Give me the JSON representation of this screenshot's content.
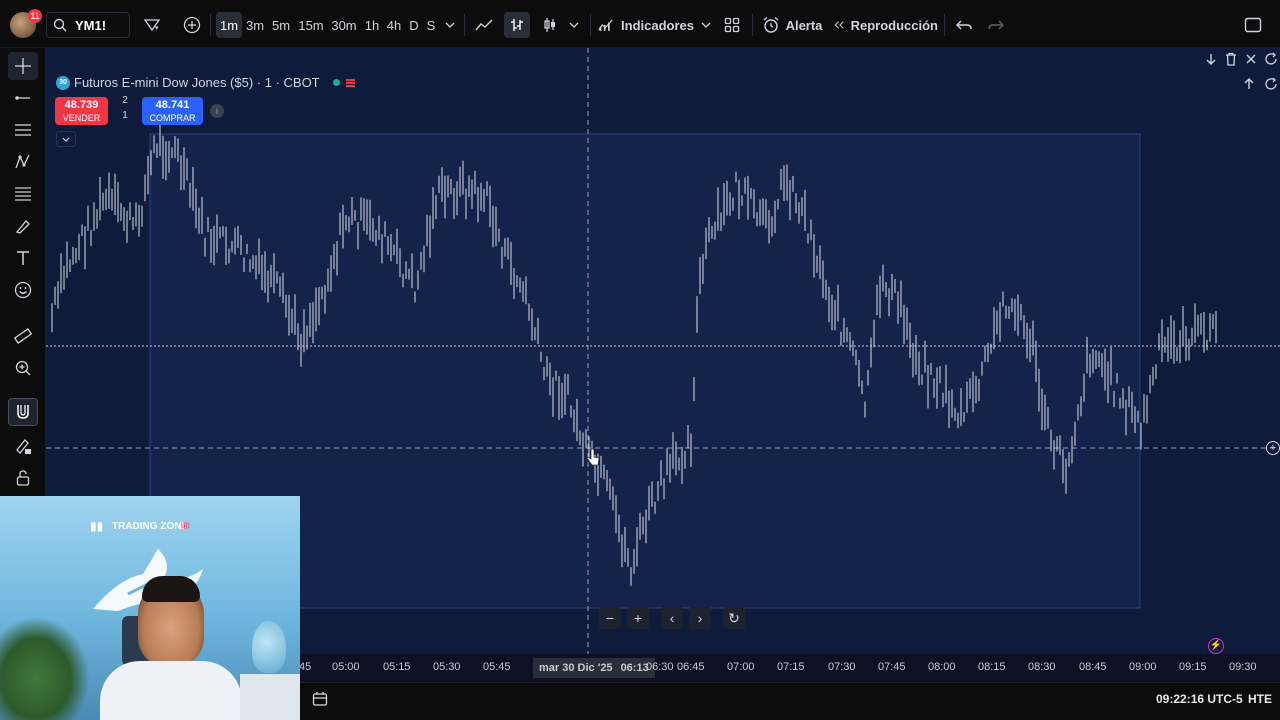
{
  "topbar": {
    "avatar_badge": "11",
    "symbol": "YM1!",
    "intervals": [
      {
        "label": "1m",
        "active": true
      },
      {
        "label": "3m"
      },
      {
        "label": "5m"
      },
      {
        "label": "15m"
      },
      {
        "label": "30m"
      },
      {
        "label": "1h"
      },
      {
        "label": "4h"
      },
      {
        "label": "D"
      },
      {
        "label": "S"
      }
    ],
    "indicators_label": "Indicadores",
    "alert_label": "Alerta",
    "replay_label": "Reproducción"
  },
  "chart": {
    "title": "Futuros E-mini Dow Jones ($5) · 1 · CBOT",
    "title_badge": "30",
    "sell": {
      "price": "48.739",
      "label": "VENDER"
    },
    "buy": {
      "price": "48.741",
      "label": "COMPRAR"
    },
    "spread_top": "2",
    "spread_bottom": "1",
    "colors": {
      "background": "#0f1b3a",
      "bar": "#d8dde9",
      "sell": "#f23645",
      "buy": "#2962ff"
    }
  },
  "time_axis": {
    "labels": [
      "45",
      "05:00",
      "05:15",
      "05:30",
      "05:45",
      "06:30",
      "06:45",
      "07:00",
      "07:15",
      "07:30",
      "07:45",
      "08:00",
      "08:15",
      "08:30",
      "08:45",
      "09:00",
      "09:15",
      "09:30"
    ],
    "crosshair_date": "mar 30 Dic '25",
    "crosshair_time": "06:13"
  },
  "bottombar": {
    "clock": "09:22:16 UTC-5",
    "session": "HTE"
  },
  "webcam": {
    "brand": "TRADING ZONE"
  }
}
